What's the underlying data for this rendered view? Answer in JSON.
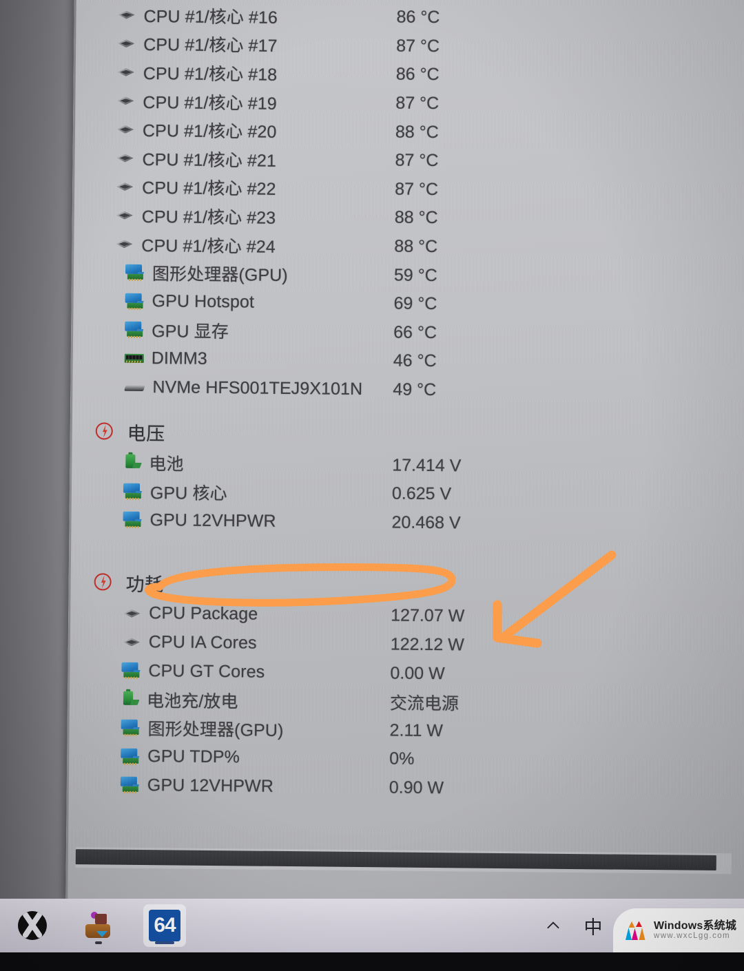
{
  "app": {
    "name": "HWiNFO64",
    "taskbar_tile_label": "64"
  },
  "sensors": {
    "temperature_rows": [
      {
        "icon": "cpu-icon",
        "label": "CPU #1/核心 #16",
        "value": "86 °C"
      },
      {
        "icon": "cpu-icon",
        "label": "CPU #1/核心 #17",
        "value": "87 °C"
      },
      {
        "icon": "cpu-icon",
        "label": "CPU #1/核心 #18",
        "value": "86 °C"
      },
      {
        "icon": "cpu-icon",
        "label": "CPU #1/核心 #19",
        "value": "87 °C"
      },
      {
        "icon": "cpu-icon",
        "label": "CPU #1/核心 #20",
        "value": "88 °C"
      },
      {
        "icon": "cpu-icon",
        "label": "CPU #1/核心 #21",
        "value": "87 °C"
      },
      {
        "icon": "cpu-icon",
        "label": "CPU #1/核心 #22",
        "value": "87 °C"
      },
      {
        "icon": "cpu-icon",
        "label": "CPU #1/核心 #23",
        "value": "88 °C"
      },
      {
        "icon": "cpu-icon",
        "label": "CPU #1/核心 #24",
        "value": "88 °C"
      },
      {
        "icon": "gpu-icon",
        "label": "图形处理器(GPU)",
        "value": "59 °C"
      },
      {
        "icon": "gpu-icon",
        "label": "GPU Hotspot",
        "value": "69 °C"
      },
      {
        "icon": "gpu-icon",
        "label": "GPU 显存",
        "value": "66 °C"
      },
      {
        "icon": "dimm-icon",
        "label": "DIMM3",
        "value": "46 °C"
      },
      {
        "icon": "drive-icon",
        "label": "NVMe HFS001TEJ9X101N",
        "value": "49 °C"
      }
    ],
    "voltage_section": {
      "title": "电压",
      "icon": "bolt-icon",
      "rows": [
        {
          "icon": "battery-icon",
          "label": "电池",
          "value": "17.414 V"
        },
        {
          "icon": "gpu-icon",
          "label": "GPU 核心",
          "value": "0.625 V"
        },
        {
          "icon": "gpu-icon",
          "label": "GPU 12VHPWR",
          "value": "20.468 V"
        }
      ]
    },
    "power_section": {
      "title": "功耗",
      "icon": "bolt-icon",
      "rows": [
        {
          "icon": "cpu-icon",
          "label": "CPU Package",
          "value": "127.07 W"
        },
        {
          "icon": "cpu-icon",
          "label": "CPU IA Cores",
          "value": "122.12 W"
        },
        {
          "icon": "gpu-icon",
          "label": "CPU GT Cores",
          "value": "0.00 W"
        },
        {
          "icon": "battery-icon",
          "label": "电池充/放电",
          "value": "交流电源"
        },
        {
          "icon": "gpu-icon",
          "label": "图形处理器(GPU)",
          "value": "2.11 W"
        },
        {
          "icon": "gpu-icon",
          "label": "GPU TDP%",
          "value": "0%"
        },
        {
          "icon": "gpu-icon",
          "label": "GPU 12VHPWR",
          "value": "0.90 W"
        }
      ]
    }
  },
  "annotations": {
    "color": "#FB9D4B",
    "highlight_oval_name": "hand-drawn-oval-under-gpu-12vhpwr",
    "arrow_name": "hand-drawn-arrow-to-cpu-package"
  },
  "taskbar": {
    "items": [
      {
        "name": "xbox-icon",
        "label": "Xbox"
      },
      {
        "name": "app-icon",
        "label": "App"
      },
      {
        "name": "hwinfo64-icon",
        "label": "64"
      }
    ],
    "tray": [
      {
        "name": "chevron-up-icon",
        "glyph": "∧"
      },
      {
        "name": "ime-chinese-icon",
        "glyph": "中"
      },
      {
        "name": "network-off-icon",
        "glyph": ""
      },
      {
        "name": "speaker-icon",
        "glyph": ""
      },
      {
        "name": "battery-charging-icon",
        "glyph": ""
      }
    ]
  },
  "watermark": {
    "title": "Windows系统城",
    "url": "www.wxcLgg.com"
  },
  "colors": {
    "annotation_orange": "#FB9D4B",
    "window_bg": "#C4C5C9",
    "text": "#3A3A3C",
    "taskbar_bg": "#D9D6E1",
    "hwinfo_blue": "#1553A8"
  }
}
